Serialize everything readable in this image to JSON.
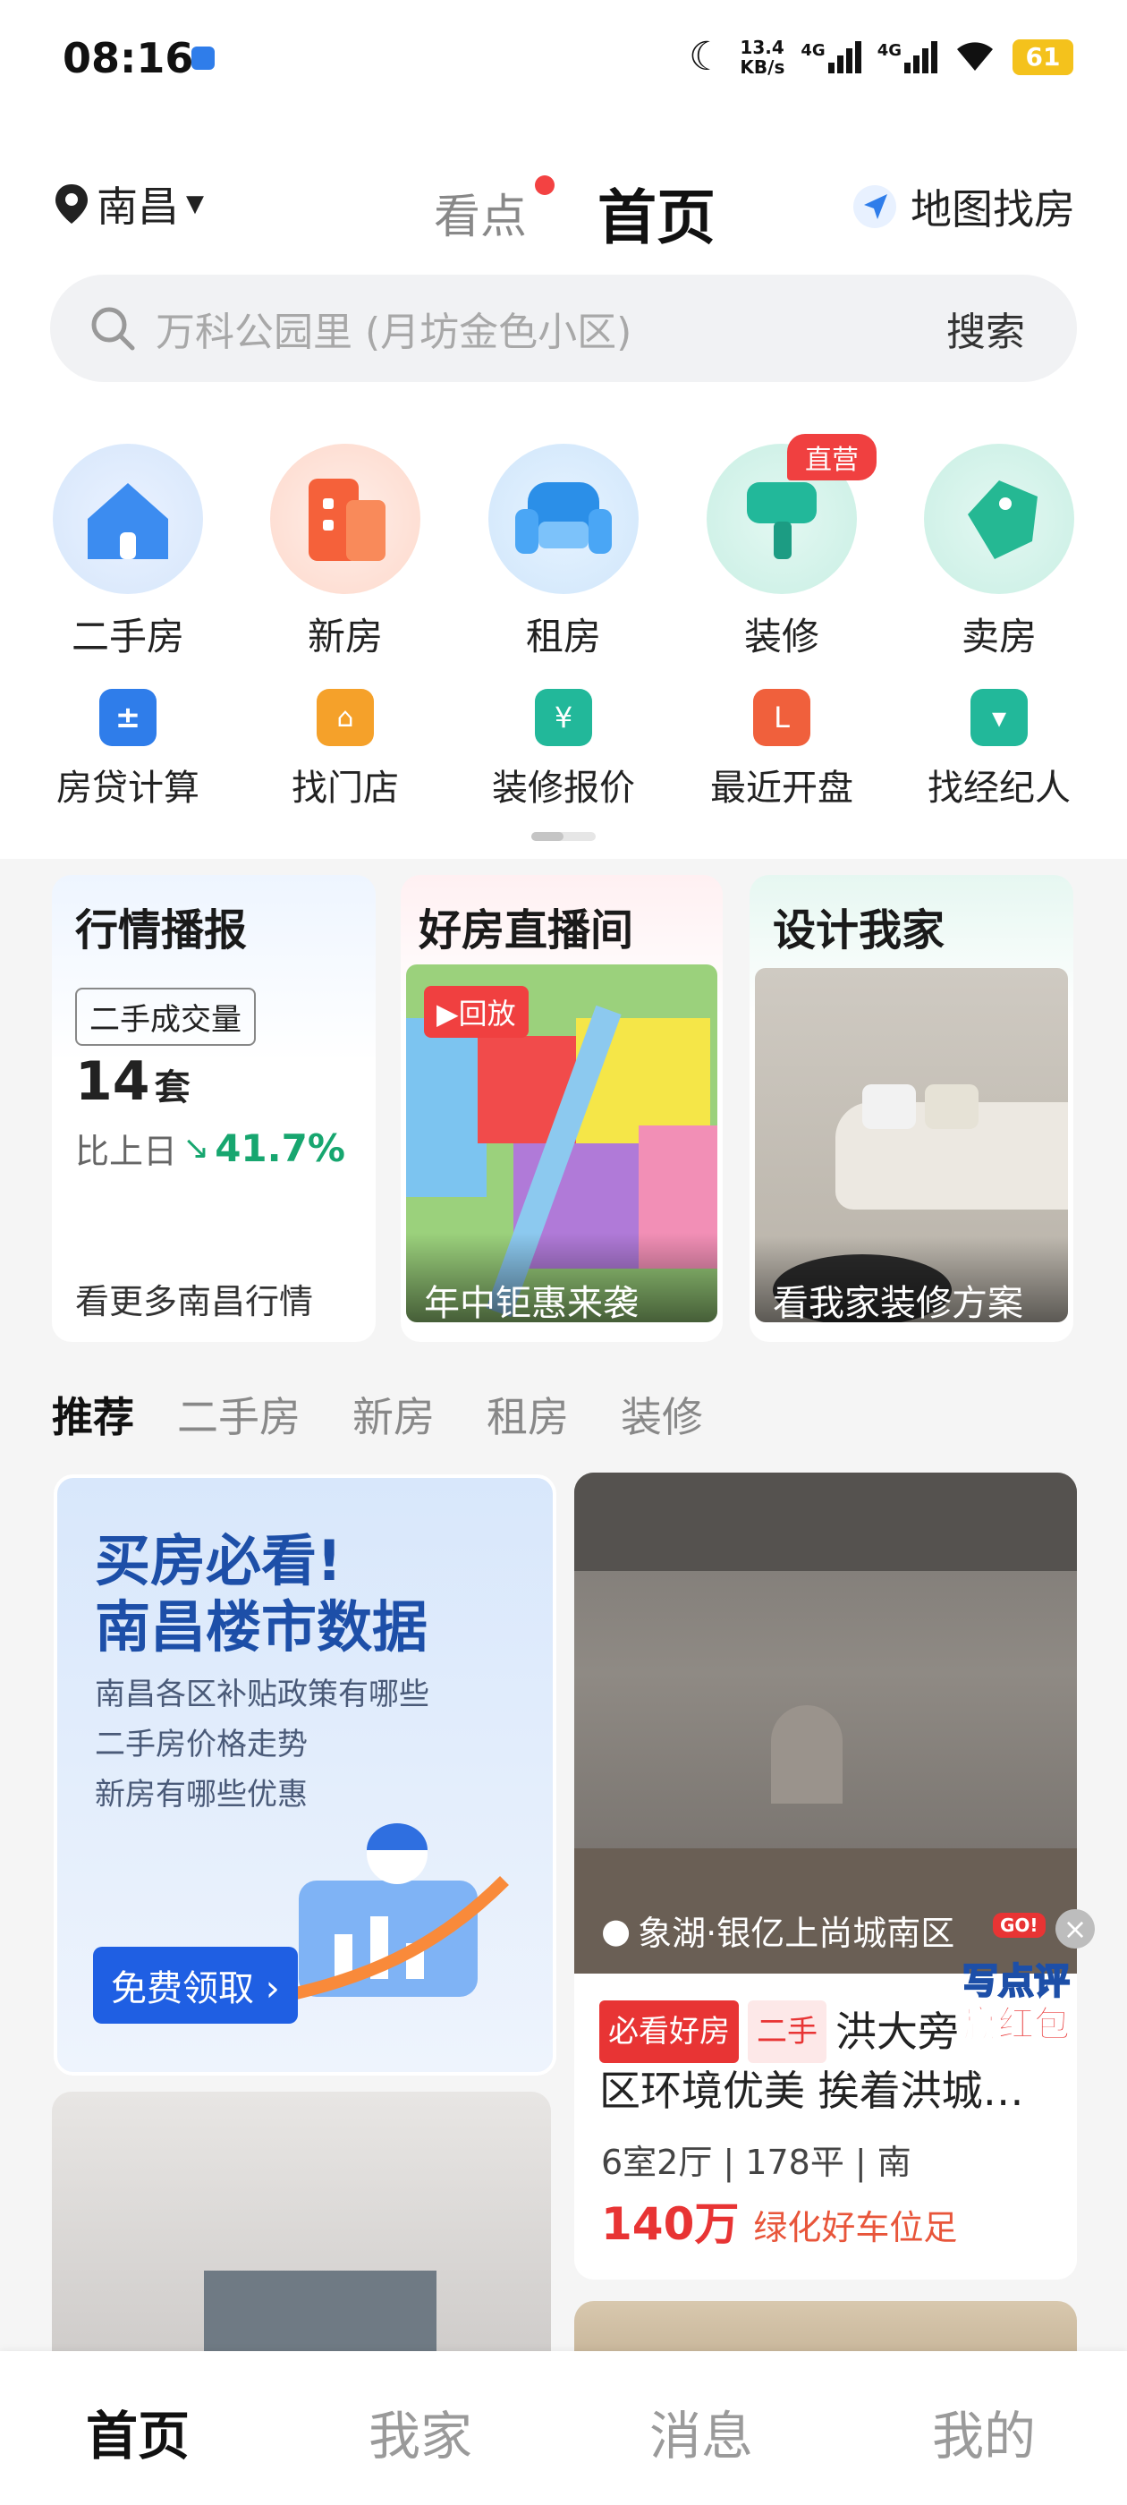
{
  "status_bar": {
    "time": "08:16",
    "net_speed_value": "13.4",
    "net_speed_unit": "KB/s",
    "sim1": "4G",
    "sim2": "4G",
    "battery": "61"
  },
  "header": {
    "city": "南昌",
    "tab_news": "看点",
    "tab_home": "首页",
    "map_search": "地图找房"
  },
  "search": {
    "placeholder": "万科公园里 (月坊金色小区)",
    "button": "搜索"
  },
  "main_entries": [
    {
      "label": "二手房",
      "color": "#2f7dea"
    },
    {
      "label": "新房",
      "color": "#f5613a"
    },
    {
      "label": "租房",
      "color": "#2b8fe8"
    },
    {
      "label": "装修",
      "color": "#22b89a"
    },
    {
      "label": "卖房",
      "color": "#25b893"
    }
  ],
  "main_entry_badge": "直营",
  "tools": [
    {
      "label": "房贷计算",
      "color": "#2f7dea"
    },
    {
      "label": "找门店",
      "color": "#f5a12a"
    },
    {
      "label": "装修报价",
      "color": "#22b89a"
    },
    {
      "label": "最近开盘",
      "color": "#f0603c"
    },
    {
      "label": "找经纪人",
      "color": "#22b89a"
    }
  ],
  "cards": {
    "market": {
      "title": "行情播报",
      "chip": "二手成交量",
      "count": "14",
      "count_unit": "套",
      "compare_label": "比上日",
      "compare_value": "41.7%",
      "footer": "看更多南昌行情"
    },
    "live": {
      "title": "好房直播间",
      "replay": "回放",
      "footer": "年中钜惠来袭"
    },
    "design": {
      "title": "设计我家",
      "footer": "看我家装修方案"
    }
  },
  "feed_tabs": [
    "推荐",
    "二手房",
    "新房",
    "租房",
    "装修"
  ],
  "promo": {
    "title_line1": "买房必看!",
    "title_line2": "南昌楼市数据",
    "bullets": [
      "南昌各区补贴政策有哪些",
      "二手房价格走势",
      "新房有哪些优惠"
    ],
    "button": "免费领取 ›"
  },
  "listing": {
    "location": "象湖·银亿上尚城南区",
    "tag1": "必看好房",
    "tag2": "二手",
    "title": "洪大旁 区环境优美 挨着洪城…",
    "title_line1": "洪大旁",
    "title_line2": "区环境优美 挨着洪城…",
    "specs": "6室2厅 | 178平 | 南",
    "price": "140万",
    "highlight": "绿化好车位足"
  },
  "floating": {
    "line1": "写点评",
    "line2": "赢红包",
    "go": "GO!"
  },
  "bottom_nav": [
    "首页",
    "我家",
    "消息",
    "我的"
  ]
}
